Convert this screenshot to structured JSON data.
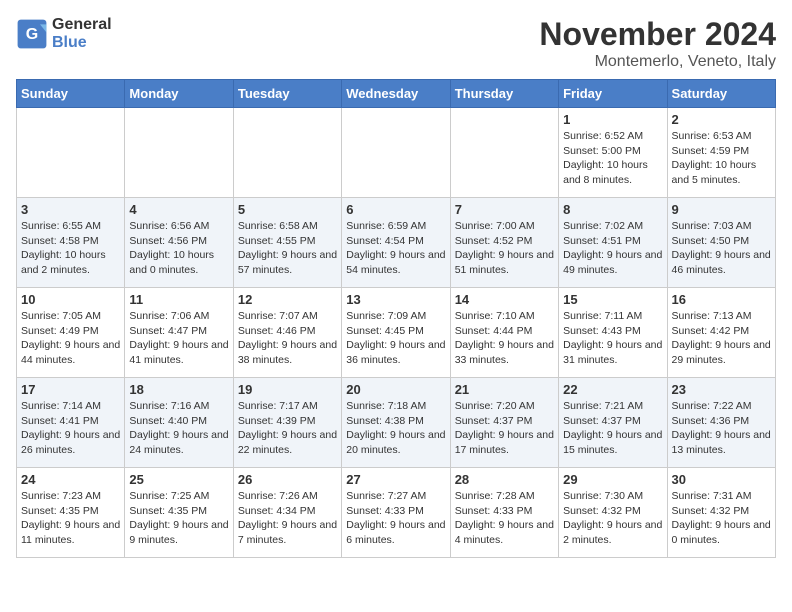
{
  "header": {
    "logo_line1": "General",
    "logo_line2": "Blue",
    "month": "November 2024",
    "location": "Montemerlo, Veneto, Italy"
  },
  "weekdays": [
    "Sunday",
    "Monday",
    "Tuesday",
    "Wednesday",
    "Thursday",
    "Friday",
    "Saturday"
  ],
  "weeks": [
    [
      {
        "day": "",
        "info": ""
      },
      {
        "day": "",
        "info": ""
      },
      {
        "day": "",
        "info": ""
      },
      {
        "day": "",
        "info": ""
      },
      {
        "day": "",
        "info": ""
      },
      {
        "day": "1",
        "info": "Sunrise: 6:52 AM\nSunset: 5:00 PM\nDaylight: 10 hours and 8 minutes."
      },
      {
        "day": "2",
        "info": "Sunrise: 6:53 AM\nSunset: 4:59 PM\nDaylight: 10 hours and 5 minutes."
      }
    ],
    [
      {
        "day": "3",
        "info": "Sunrise: 6:55 AM\nSunset: 4:58 PM\nDaylight: 10 hours and 2 minutes."
      },
      {
        "day": "4",
        "info": "Sunrise: 6:56 AM\nSunset: 4:56 PM\nDaylight: 10 hours and 0 minutes."
      },
      {
        "day": "5",
        "info": "Sunrise: 6:58 AM\nSunset: 4:55 PM\nDaylight: 9 hours and 57 minutes."
      },
      {
        "day": "6",
        "info": "Sunrise: 6:59 AM\nSunset: 4:54 PM\nDaylight: 9 hours and 54 minutes."
      },
      {
        "day": "7",
        "info": "Sunrise: 7:00 AM\nSunset: 4:52 PM\nDaylight: 9 hours and 51 minutes."
      },
      {
        "day": "8",
        "info": "Sunrise: 7:02 AM\nSunset: 4:51 PM\nDaylight: 9 hours and 49 minutes."
      },
      {
        "day": "9",
        "info": "Sunrise: 7:03 AM\nSunset: 4:50 PM\nDaylight: 9 hours and 46 minutes."
      }
    ],
    [
      {
        "day": "10",
        "info": "Sunrise: 7:05 AM\nSunset: 4:49 PM\nDaylight: 9 hours and 44 minutes."
      },
      {
        "day": "11",
        "info": "Sunrise: 7:06 AM\nSunset: 4:47 PM\nDaylight: 9 hours and 41 minutes."
      },
      {
        "day": "12",
        "info": "Sunrise: 7:07 AM\nSunset: 4:46 PM\nDaylight: 9 hours and 38 minutes."
      },
      {
        "day": "13",
        "info": "Sunrise: 7:09 AM\nSunset: 4:45 PM\nDaylight: 9 hours and 36 minutes."
      },
      {
        "day": "14",
        "info": "Sunrise: 7:10 AM\nSunset: 4:44 PM\nDaylight: 9 hours and 33 minutes."
      },
      {
        "day": "15",
        "info": "Sunrise: 7:11 AM\nSunset: 4:43 PM\nDaylight: 9 hours and 31 minutes."
      },
      {
        "day": "16",
        "info": "Sunrise: 7:13 AM\nSunset: 4:42 PM\nDaylight: 9 hours and 29 minutes."
      }
    ],
    [
      {
        "day": "17",
        "info": "Sunrise: 7:14 AM\nSunset: 4:41 PM\nDaylight: 9 hours and 26 minutes."
      },
      {
        "day": "18",
        "info": "Sunrise: 7:16 AM\nSunset: 4:40 PM\nDaylight: 9 hours and 24 minutes."
      },
      {
        "day": "19",
        "info": "Sunrise: 7:17 AM\nSunset: 4:39 PM\nDaylight: 9 hours and 22 minutes."
      },
      {
        "day": "20",
        "info": "Sunrise: 7:18 AM\nSunset: 4:38 PM\nDaylight: 9 hours and 20 minutes."
      },
      {
        "day": "21",
        "info": "Sunrise: 7:20 AM\nSunset: 4:37 PM\nDaylight: 9 hours and 17 minutes."
      },
      {
        "day": "22",
        "info": "Sunrise: 7:21 AM\nSunset: 4:37 PM\nDaylight: 9 hours and 15 minutes."
      },
      {
        "day": "23",
        "info": "Sunrise: 7:22 AM\nSunset: 4:36 PM\nDaylight: 9 hours and 13 minutes."
      }
    ],
    [
      {
        "day": "24",
        "info": "Sunrise: 7:23 AM\nSunset: 4:35 PM\nDaylight: 9 hours and 11 minutes."
      },
      {
        "day": "25",
        "info": "Sunrise: 7:25 AM\nSunset: 4:35 PM\nDaylight: 9 hours and 9 minutes."
      },
      {
        "day": "26",
        "info": "Sunrise: 7:26 AM\nSunset: 4:34 PM\nDaylight: 9 hours and 7 minutes."
      },
      {
        "day": "27",
        "info": "Sunrise: 7:27 AM\nSunset: 4:33 PM\nDaylight: 9 hours and 6 minutes."
      },
      {
        "day": "28",
        "info": "Sunrise: 7:28 AM\nSunset: 4:33 PM\nDaylight: 9 hours and 4 minutes."
      },
      {
        "day": "29",
        "info": "Sunrise: 7:30 AM\nSunset: 4:32 PM\nDaylight: 9 hours and 2 minutes."
      },
      {
        "day": "30",
        "info": "Sunrise: 7:31 AM\nSunset: 4:32 PM\nDaylight: 9 hours and 0 minutes."
      }
    ]
  ],
  "colors": {
    "header_bg": "#4a7ec7",
    "col_odd": "#f5f7fa",
    "col_even": "#ffffff"
  }
}
